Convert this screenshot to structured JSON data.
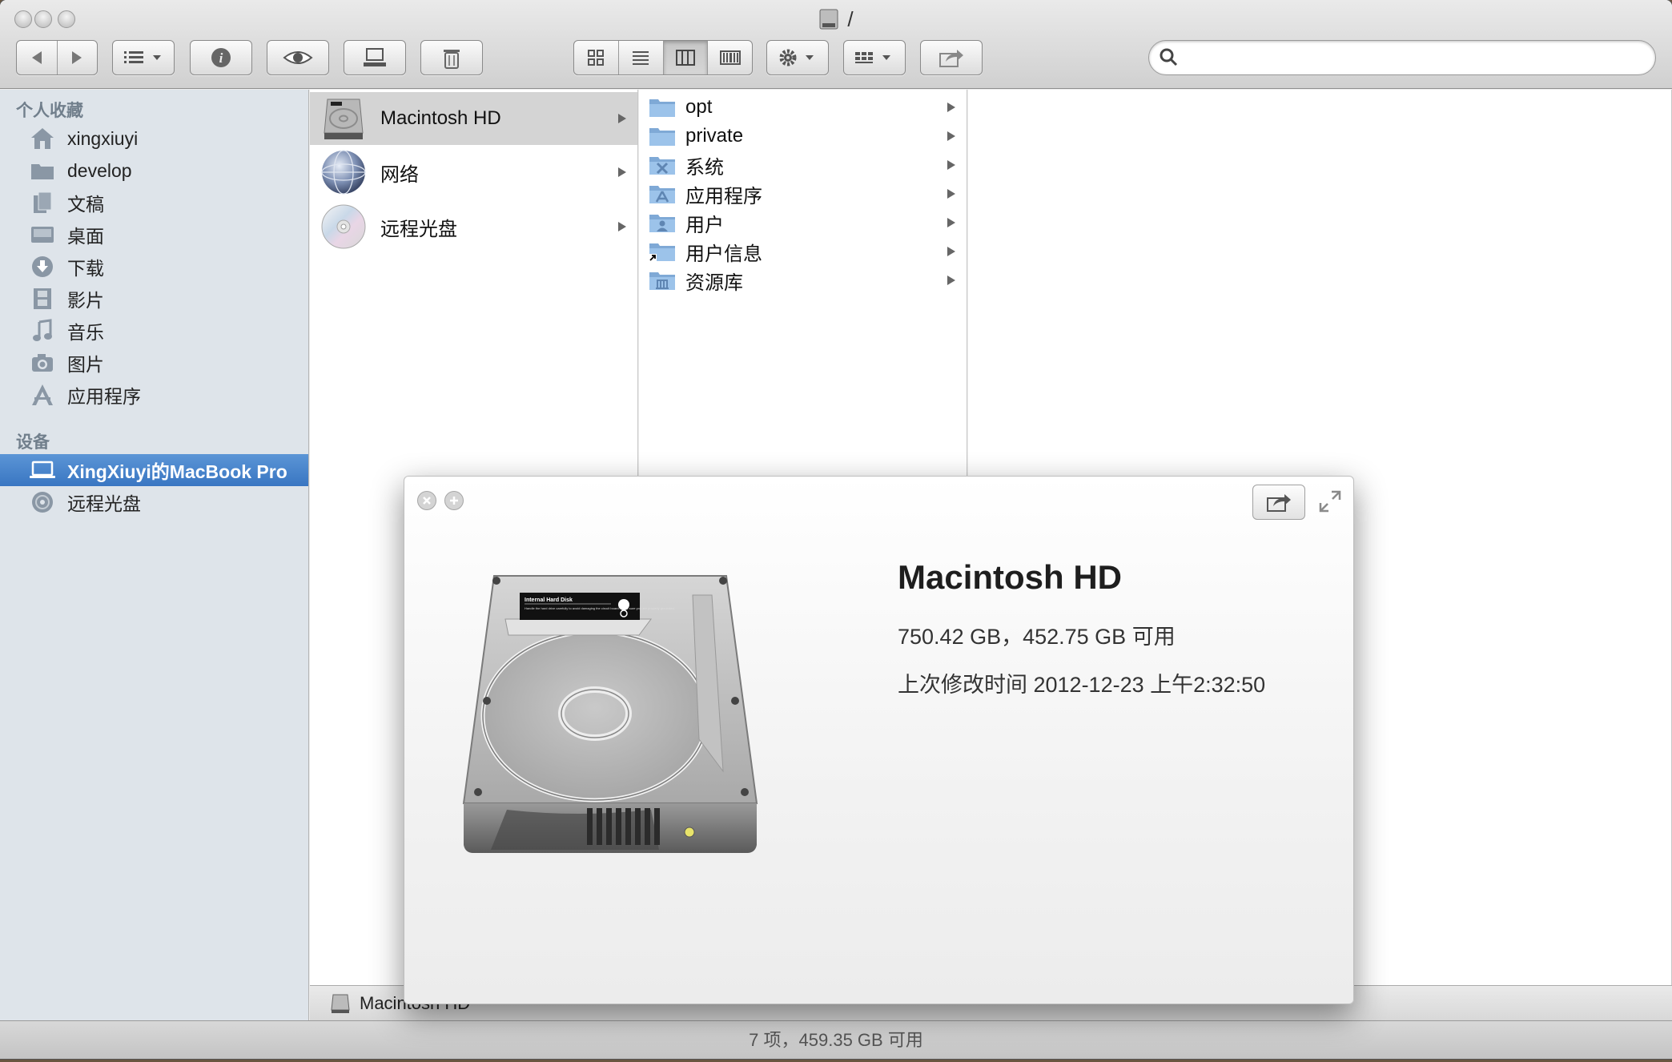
{
  "window": {
    "title": "/"
  },
  "search": {
    "placeholder": "",
    "value": ""
  },
  "sidebar": {
    "favorites_header": "个人收藏",
    "favorites": [
      {
        "label": "xingxiuyi",
        "icon": "home-icon"
      },
      {
        "label": "develop",
        "icon": "folder-icon"
      },
      {
        "label": "文稿",
        "icon": "documents-icon"
      },
      {
        "label": "桌面",
        "icon": "desktop-icon"
      },
      {
        "label": "下载",
        "icon": "download-icon"
      },
      {
        "label": "影片",
        "icon": "movies-icon"
      },
      {
        "label": "音乐",
        "icon": "music-icon"
      },
      {
        "label": "图片",
        "icon": "camera-icon"
      },
      {
        "label": "应用程序",
        "icon": "applications-icon"
      }
    ],
    "devices_header": "设备",
    "devices": [
      {
        "label": "XingXiuyi的MacBook Pro",
        "icon": "laptop-icon",
        "selected": true
      },
      {
        "label": "远程光盘",
        "icon": "disc-icon"
      }
    ]
  },
  "column1": {
    "items": [
      {
        "label": "Macintosh HD",
        "icon": "hard-disk-icon",
        "selected": true
      },
      {
        "label": "网络",
        "icon": "network-globe-icon"
      },
      {
        "label": "远程光盘",
        "icon": "optical-disc-icon"
      }
    ]
  },
  "column2": {
    "items": [
      {
        "label": "opt",
        "icon": "folder-icon"
      },
      {
        "label": "private",
        "icon": "folder-icon"
      },
      {
        "label": "系统",
        "icon": "system-folder-icon"
      },
      {
        "label": "应用程序",
        "icon": "applications-folder-icon"
      },
      {
        "label": "用户",
        "icon": "users-folder-icon"
      },
      {
        "label": "用户信息",
        "icon": "alias-folder-icon"
      },
      {
        "label": "资源库",
        "icon": "library-folder-icon"
      }
    ]
  },
  "pathbar": {
    "label": "Macintosh HD"
  },
  "statusbar": {
    "text": "7 项，459.35 GB 可用"
  },
  "quicklook": {
    "name": "Macintosh HD",
    "capacity": "750.42 GB，452.75 GB 可用",
    "modified": "上次修改时间 2012-12-23 上午2:32:50",
    "disk_label_title": "Internal Hard Disk",
    "disk_label_text": "Handle the hard drive carefully to avoid damaging the circuit board. Make sure you are properly grounded."
  },
  "colors": {
    "selection": "#3976c2",
    "sidebar_bg": "#dee4ea",
    "folder_blue": "#8fb8e0"
  }
}
